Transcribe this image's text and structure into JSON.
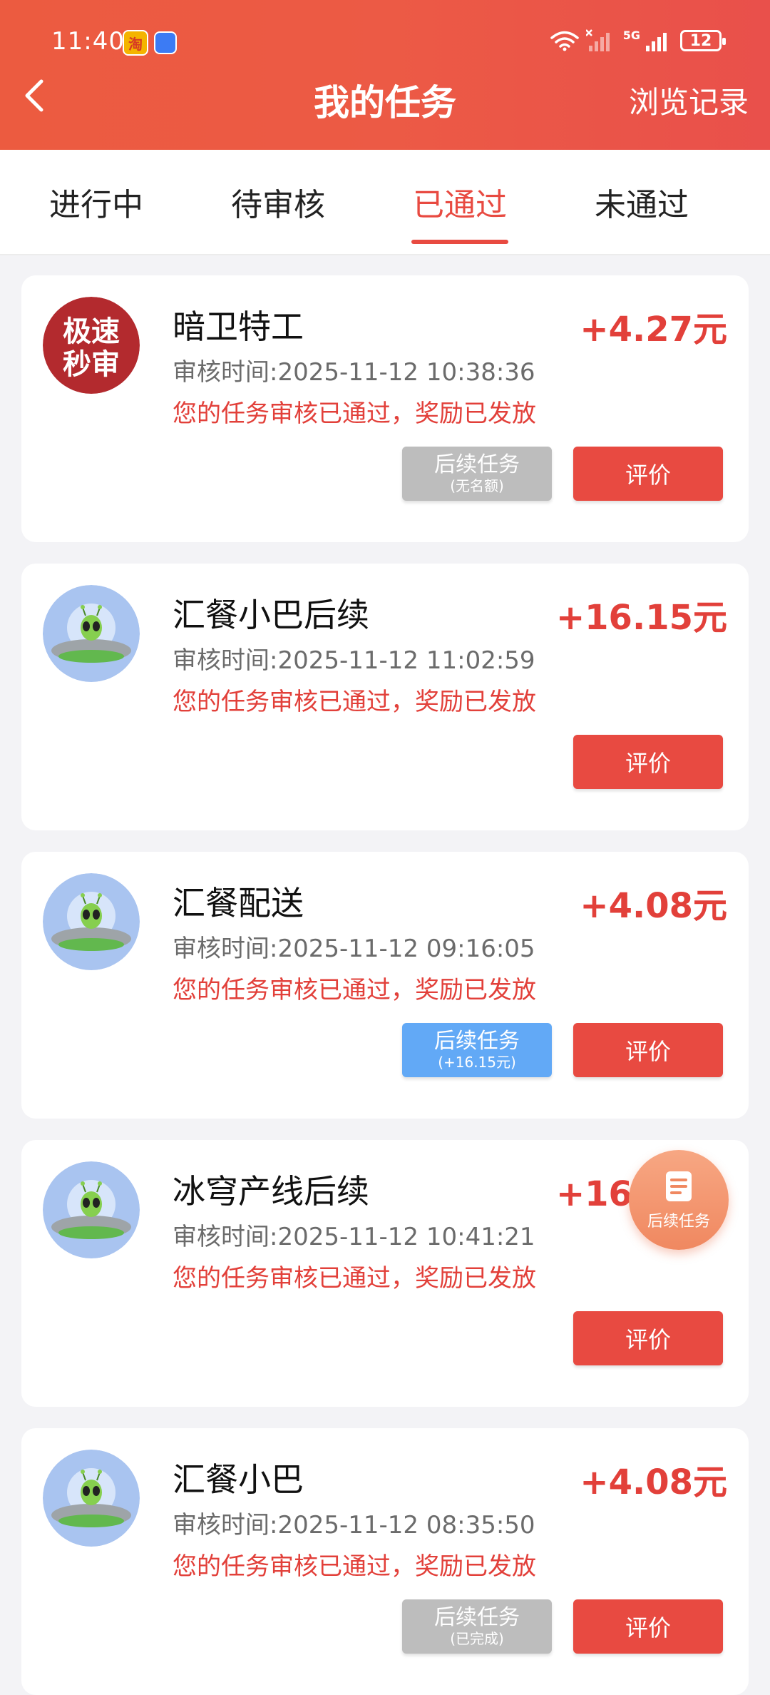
{
  "status_bar": {
    "time": "11:40",
    "network": "5G",
    "battery": "12",
    "app_icon_1": "淘"
  },
  "header": {
    "title": "我的任务",
    "history_label": "浏览记录"
  },
  "tabs": [
    {
      "label": "进行中",
      "active": false
    },
    {
      "label": "待审核",
      "active": false
    },
    {
      "label": "已通过",
      "active": true
    },
    {
      "label": "未通过",
      "active": false
    }
  ],
  "tasks": [
    {
      "name": "暗卫特工",
      "reward": "+4.27元",
      "review_time": "审核时间:2025-11-12 10:38:36",
      "status": "您的任务审核已通过，奖励已发放",
      "avatar_text": [
        "极速",
        "秒审"
      ],
      "follow_up": {
        "label": "后续任务",
        "sub": "(无名额)",
        "style": "gray"
      },
      "rate_label": "评价"
    },
    {
      "name": "汇餐小巴后续",
      "reward": "+16.15元",
      "review_time": "审核时间:2025-11-12 11:02:59",
      "status": "您的任务审核已通过，奖励已发放",
      "rate_label": "评价"
    },
    {
      "name": "汇餐配送",
      "reward": "+4.08元",
      "review_time": "审核时间:2025-11-12 09:16:05",
      "status": "您的任务审核已通过，奖励已发放",
      "follow_up": {
        "label": "后续任务",
        "sub": "(+16.15元)",
        "style": "blue"
      },
      "rate_label": "评价"
    },
    {
      "name": "冰穹产线后续",
      "reward": "+16.15元",
      "review_time": "审核时间:2025-11-12 10:41:21",
      "status": "您的任务审核已通过，奖励已发放",
      "rate_label": "评价"
    },
    {
      "name": "汇餐小巴",
      "reward": "+4.08元",
      "review_time": "审核时间:2025-11-12 08:35:50",
      "status": "您的任务审核已通过，奖励已发放",
      "follow_up": {
        "label": "后续任务",
        "sub": "(已完成)",
        "style": "gray"
      },
      "rate_label": "评价"
    }
  ],
  "floating_button": {
    "label": "后续任务",
    "icon": "document-list-icon"
  },
  "colors": {
    "accent": "#e84a41",
    "header": "#ec5a45",
    "blue_button": "#62a9f6",
    "gray_button": "#bdbdbd"
  }
}
